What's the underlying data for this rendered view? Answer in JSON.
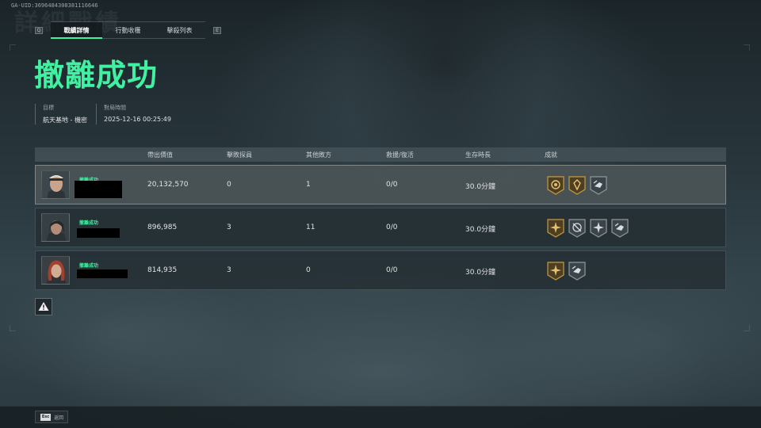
{
  "uid": "GA-UID:3696484308381116646",
  "watermark_title": "詳細戰績",
  "tabs": {
    "left_key": "Q",
    "right_key": "E",
    "items": [
      {
        "label": "戰績詳情",
        "active": true
      },
      {
        "label": "行動收穫",
        "active": false
      },
      {
        "label": "擊殺列表",
        "active": false
      }
    ]
  },
  "result_title": "撤離成功",
  "info": {
    "target_label": "目標",
    "target_value": "航天基地 - 機密",
    "time_label": "對局時間",
    "time_value": "2025-12-16 00:25:49"
  },
  "table": {
    "headers": [
      "帶出價值",
      "擊敗探員",
      "其他敗方",
      "救援/復活",
      "生存時長",
      "成就"
    ],
    "rows": [
      {
        "status": "撤離成功",
        "value": "20,132,570",
        "kills": "0",
        "other": "1",
        "rescue": "0/0",
        "time": "30.0分鐘",
        "badges": [
          "gold-medal-icon",
          "gold-medal-icon",
          "hand-badge-icon"
        ],
        "highlight": true
      },
      {
        "status": "撤離成功",
        "value": "896,985",
        "kills": "3",
        "other": "11",
        "rescue": "0/0",
        "time": "30.0分鐘",
        "badges": [
          "gold-star-icon",
          "crosshair-badge-icon",
          "burst-badge-icon",
          "hand-badge-icon"
        ],
        "highlight": false
      },
      {
        "status": "撤離成功",
        "value": "814,935",
        "kills": "3",
        "other": "0",
        "rescue": "0/0",
        "time": "30.0分鐘",
        "badges": [
          "gold-star-icon",
          "hand-badge-icon"
        ],
        "highlight": false
      }
    ]
  },
  "footer": {
    "esc_key": "Esc",
    "back_label": "返回"
  },
  "colors": {
    "accent": "#41f0a0",
    "gold": "#b08a3a"
  }
}
